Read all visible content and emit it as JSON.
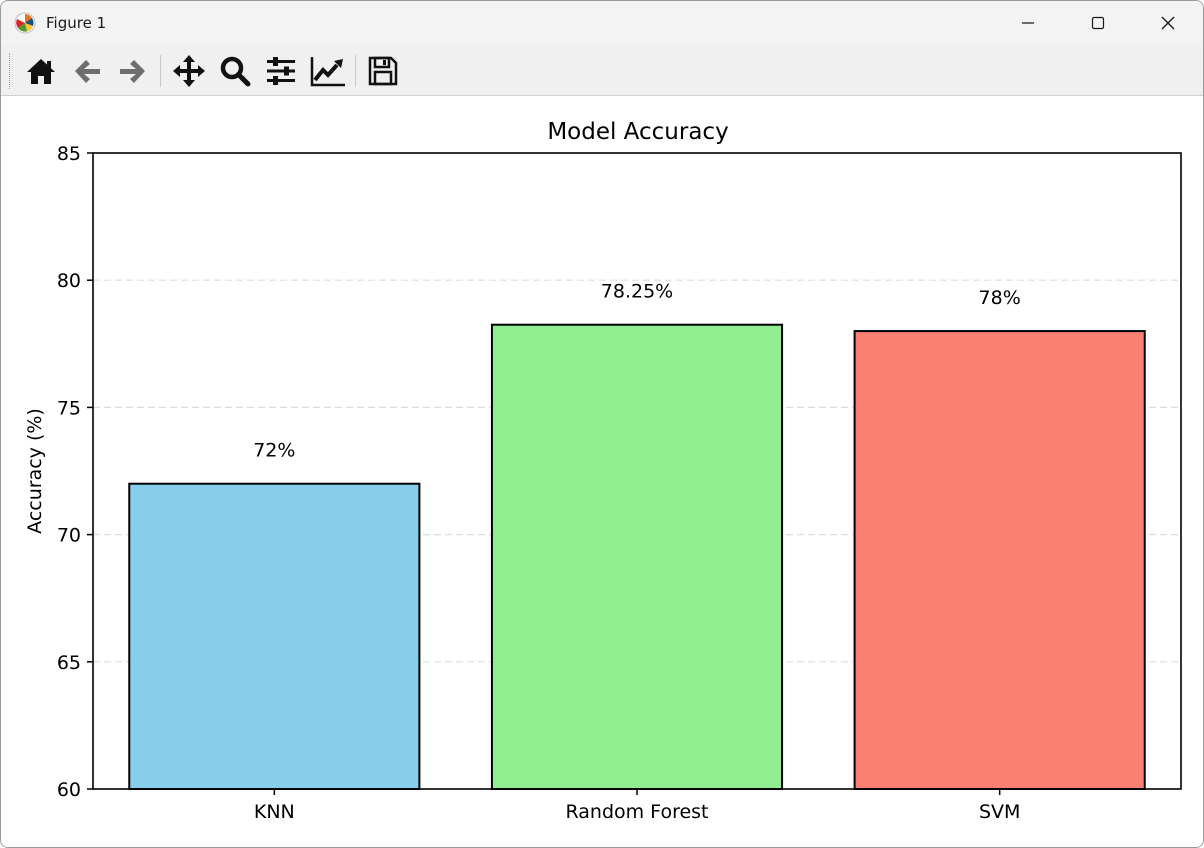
{
  "window": {
    "title": "Figure 1",
    "icon": "matplotlib-logo-icon",
    "controls": [
      "minimize-icon",
      "maximize-icon",
      "close-icon"
    ]
  },
  "toolbar": {
    "tools": [
      {
        "name": "home",
        "icon": "home-icon"
      },
      {
        "name": "back",
        "icon": "arrow-left-icon"
      },
      {
        "name": "forward",
        "icon": "arrow-right-icon"
      },
      {
        "name": "pan",
        "icon": "move-icon"
      },
      {
        "name": "zoom",
        "icon": "magnifier-icon"
      },
      {
        "name": "subplots",
        "icon": "sliders-icon"
      },
      {
        "name": "customize",
        "icon": "line-chart-icon"
      },
      {
        "name": "save",
        "icon": "floppy-disk-icon"
      }
    ]
  },
  "chart_data": {
    "type": "bar",
    "title": "Model Accuracy",
    "xlabel": "",
    "ylabel": "Accuracy (%)",
    "categories": [
      "KNN",
      "Random Forest",
      "SVM"
    ],
    "values": [
      72,
      78.25,
      78
    ],
    "value_labels": [
      "72%",
      "78.25%",
      "78%"
    ],
    "colors": [
      "#87ceeb",
      "#90ee90",
      "#fa8072"
    ],
    "edge_color": "#000000",
    "ylim": [
      60,
      85
    ],
    "yticks": [
      60,
      65,
      70,
      75,
      80,
      85
    ],
    "grid": {
      "axis": "y",
      "style": "dashed",
      "color": "#dddddd"
    },
    "legend": "none"
  }
}
